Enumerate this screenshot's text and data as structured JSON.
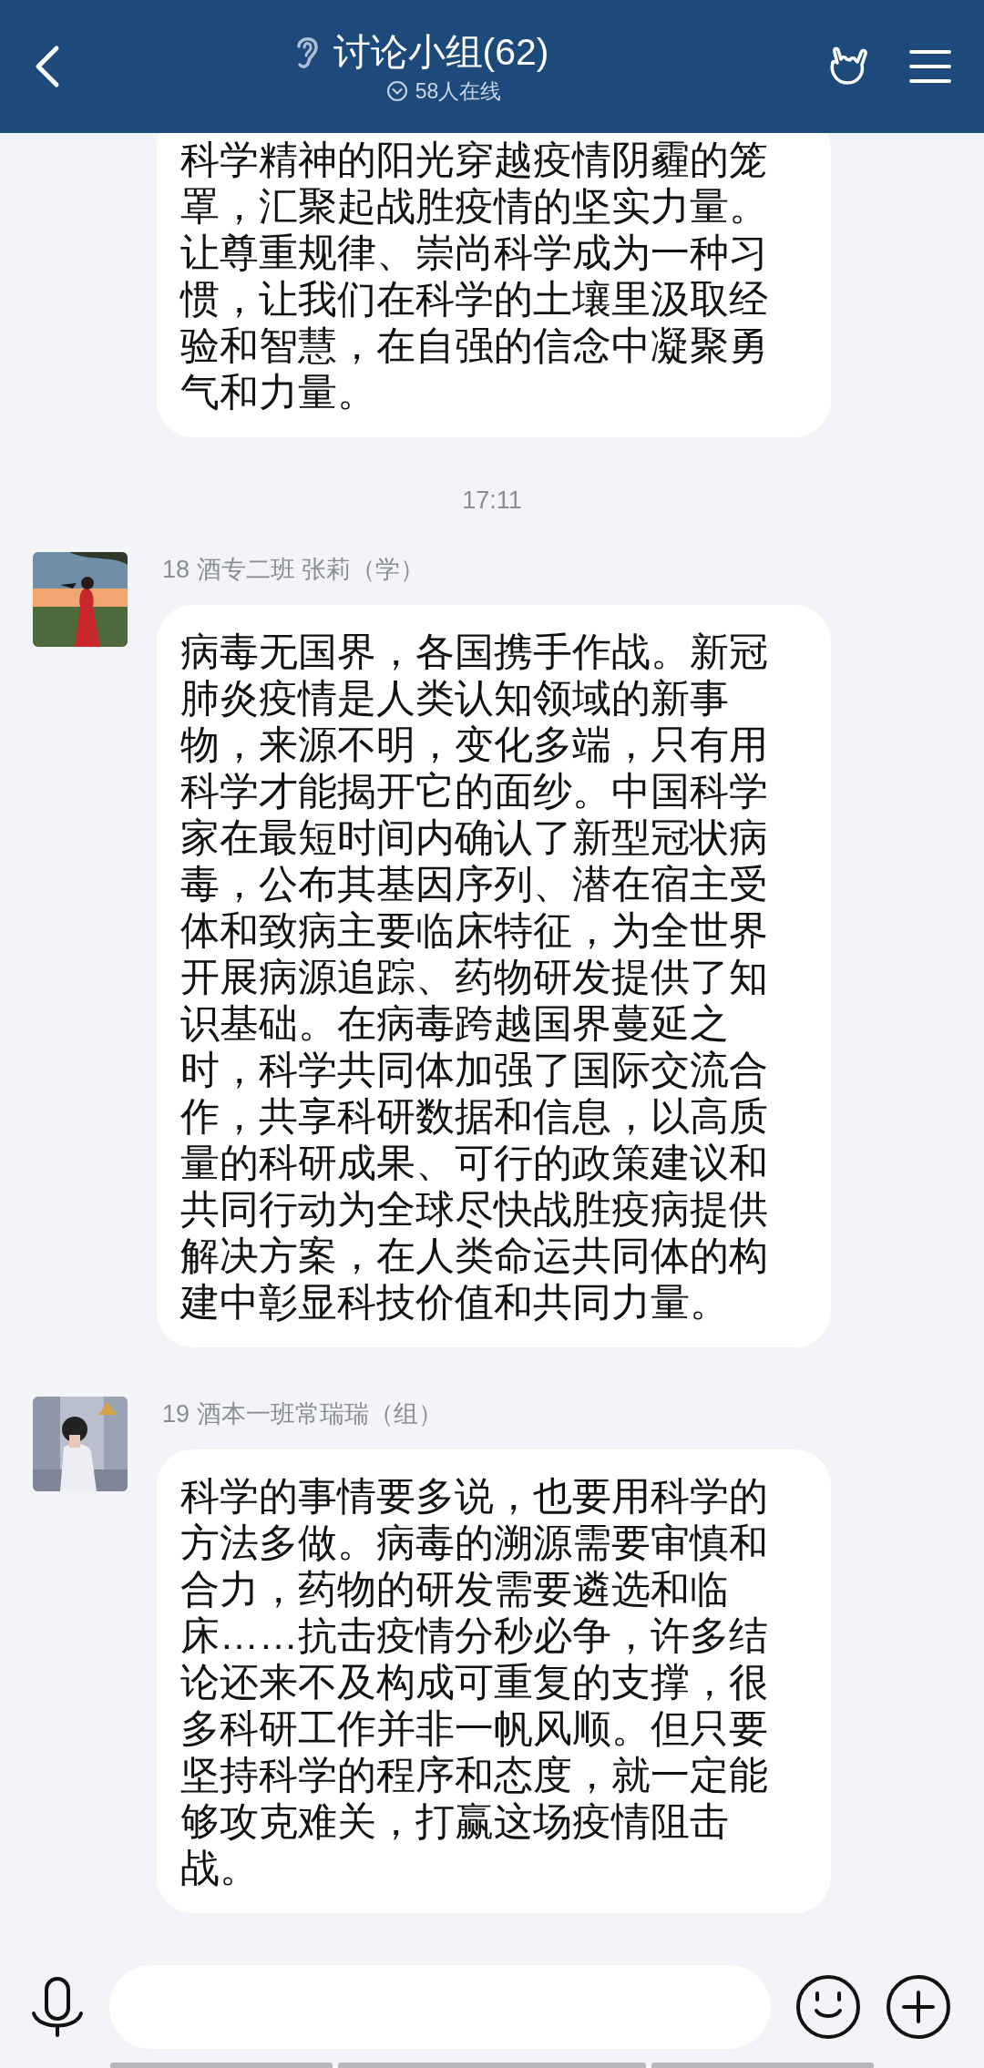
{
  "header": {
    "title": "讨论小组(62)",
    "online": "58人在线"
  },
  "messages": [
    {
      "kind": "bubble",
      "text": "科学精神的阳光穿越疫情阴霾的笼罩，汇聚起战胜疫情的坚实力量。让尊重规律、崇尚科学成为一种习惯，让我们在科学的土壤里汲取经验和智慧，在自强的信念中凝聚勇气和力量。"
    },
    {
      "kind": "time",
      "text": "17:11"
    },
    {
      "kind": "message",
      "sender": "18 酒专二班 张莉（学）",
      "text": "病毒无国界，各国携手作战。新冠肺炎疫情是人类认知领域的新事物，来源不明，变化多端，只有用科学才能揭开它的面纱。中国科学家在最短时间内确认了新型冠状病毒，公布其基因序列、潜在宿主受体和致病主要临床特征，为全世界开展病源追踪、药物研发提供了知识基础。在病毒跨越国界蔓延之时，科学共同体加强了国际交流合作，共享科研数据和信息，以高质量的科研成果、可行的政策建议和共同行动为全球尽快战胜疫病提供解决方案，在人类命运共同体的构建中彰显科技价值和共同力量。"
    },
    {
      "kind": "message",
      "sender": "19 酒本一班常瑞瑞（组）",
      "text": "科学的事情要多说，也要用科学的方法多做。病毒的溯源需要审慎和合力，药物的研发需要遴选和临床……抗击疫情分秒必争，许多结论还来不及构成可重复的支撑，很多科研工作并非一帆风顺。但只要坚持科学的程序和态度，就一定能够攻克难关，打赢这场疫情阻击战。"
    }
  ]
}
